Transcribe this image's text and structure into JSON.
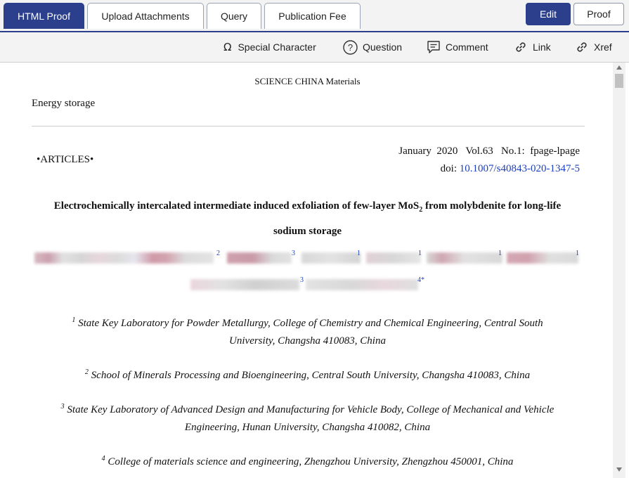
{
  "tabs": [
    {
      "label": "HTML Proof",
      "active": true
    },
    {
      "label": "Upload Attachments",
      "active": false
    },
    {
      "label": "Query",
      "active": false
    },
    {
      "label": "Publication Fee",
      "active": false
    }
  ],
  "actions": {
    "edit": "Edit",
    "proof": "Proof"
  },
  "toolbar": {
    "special_character": "Special Character",
    "question": "Question",
    "comment": "Comment",
    "link": "Link",
    "xref": "Xref"
  },
  "doc": {
    "journal": "SCIENCE CHINA Materials",
    "section": "Energy storage",
    "article_type": "•ARTICLES•",
    "issue_line": "January  2020   Vol.63   No.1:  fpage-lpage",
    "doi_prefix": "doi: ",
    "doi": "10.1007/s40843-020-1347-5",
    "title_line1_a": "Electrochemically intercalated intermediate induced exfoliation of few-layer MoS",
    "title_sub": "2",
    "title_line1_b": " from molybdenite for long-life",
    "title_line2": "sodium storage",
    "author_marks": [
      "2",
      "3",
      "1",
      "1",
      "1",
      "1"
    ],
    "author_marks_line2": [
      "3",
      "4*"
    ],
    "affiliations": [
      {
        "num": "1",
        "line1": "State Key Laboratory for Powder Metallurgy, College of Chemistry and Chemical Engineering, Central South",
        "line2": "University, Changsha 410083, China"
      },
      {
        "num": "2",
        "line1": "School of Minerals Processing and Bioengineering, Central South University, Changsha 410083, China",
        "line2": ""
      },
      {
        "num": "3",
        "line1": "State Key Laboratory of Advanced Design and Manufacturing for Vehicle Body, College of Mechanical and Vehicle",
        "line2": "Engineering, Hunan University, Changsha 410082, China"
      },
      {
        "num": "4",
        "line1": "College of materials science and engineering, Zhengzhou University, Zhengzhou 450001, China",
        "line2": ""
      }
    ]
  },
  "colors": {
    "primary": "#2b3f8c",
    "link": "#1a3fbf"
  }
}
